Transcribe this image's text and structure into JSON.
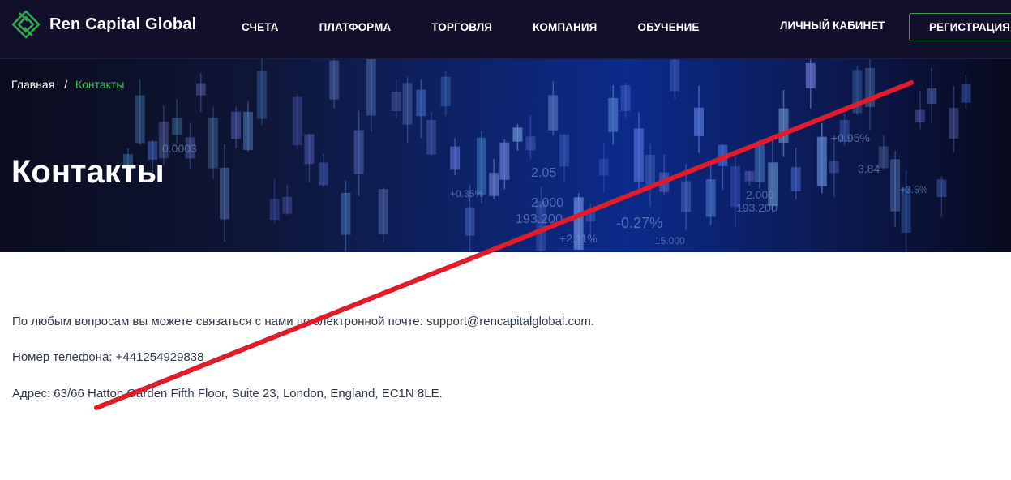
{
  "brand": {
    "name": "Ren Capital Global",
    "accent": "#2ea84d",
    "nav_bg": "#120f2b"
  },
  "nav": {
    "items": [
      {
        "label": "СЧЕТА"
      },
      {
        "label": "ПЛАТФОРМА"
      },
      {
        "label": "ТОРГОВЛЯ"
      },
      {
        "label": "КОМПАНИЯ"
      },
      {
        "label": "ОБУЧЕНИЕ"
      }
    ],
    "cabinet": "ЛИЧНЫЙ КАБИНЕТ",
    "register": "РЕГИСТРАЦИЯ"
  },
  "breadcrumb": {
    "home": "Главная",
    "separator": "/",
    "current": "Контакты"
  },
  "hero": {
    "title": "Контакты",
    "bg_labels": [
      "0.0003",
      "+0.35%",
      "2.05",
      "2.000",
      "193.200",
      "-0.27%",
      "15.000",
      "+2.11%",
      "+0.95%",
      "3.84",
      "2.000",
      "193.200",
      "+3.5%"
    ]
  },
  "contacts": {
    "email_line": "По любым вопросам вы можете связаться с нами по электронной почте: support@rencapitalglobal.com.",
    "phone_line": "Номер телефона: +441254929838",
    "address_line": "Адрес: 63/66 Hatton Garden Fifth Floor, Suite 23, London, England, EC1N 8LE."
  },
  "overlay": {
    "strike_color": "#e01b2a"
  }
}
